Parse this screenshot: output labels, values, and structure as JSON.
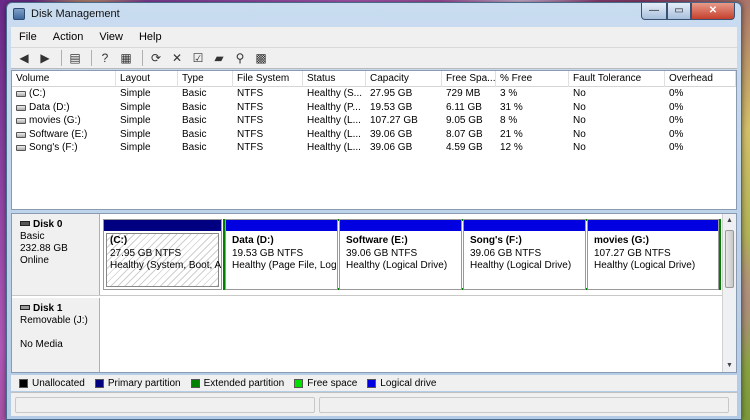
{
  "window": {
    "title": "Disk Management",
    "min_label": "—",
    "max_label": "▭",
    "close_label": "✕"
  },
  "menu": [
    "File",
    "Action",
    "View",
    "Help"
  ],
  "toolbar": {
    "buttons": [
      {
        "name": "back-arrow-icon",
        "glyph": "◀"
      },
      {
        "name": "forward-arrow-icon",
        "glyph": "▶"
      },
      {
        "name": "console-tree-icon",
        "glyph": "▤"
      },
      {
        "name": "help-icon",
        "glyph": "?"
      },
      {
        "name": "properties-icon",
        "glyph": "▦"
      },
      {
        "name": "refresh-icon",
        "glyph": "⟳"
      },
      {
        "name": "delete-icon",
        "glyph": "✕"
      },
      {
        "name": "check-icon",
        "glyph": "☑"
      },
      {
        "name": "open-folder-icon",
        "glyph": "▰"
      },
      {
        "name": "search-icon",
        "glyph": "⚲"
      },
      {
        "name": "grid-icon",
        "glyph": "▩"
      }
    ]
  },
  "volumes": {
    "columns": [
      "Volume",
      "Layout",
      "Type",
      "File System",
      "Status",
      "Capacity",
      "Free Spa...",
      "% Free",
      "Fault Tolerance",
      "Overhead"
    ],
    "rows": [
      [
        "(C:)",
        "Simple",
        "Basic",
        "NTFS",
        "Healthy (S...",
        "27.95 GB",
        "729 MB",
        "3 %",
        "No",
        "0%"
      ],
      [
        "Data (D:)",
        "Simple",
        "Basic",
        "NTFS",
        "Healthy (P...",
        "19.53 GB",
        "6.11 GB",
        "31 %",
        "No",
        "0%"
      ],
      [
        "movies (G:)",
        "Simple",
        "Basic",
        "NTFS",
        "Healthy (L...",
        "107.27 GB",
        "9.05 GB",
        "8 %",
        "No",
        "0%"
      ],
      [
        "Software (E:)",
        "Simple",
        "Basic",
        "NTFS",
        "Healthy (L...",
        "39.06 GB",
        "8.07 GB",
        "21 %",
        "No",
        "0%"
      ],
      [
        "Song's (F:)",
        "Simple",
        "Basic",
        "NTFS",
        "Healthy (L...",
        "39.06 GB",
        "4.59 GB",
        "12 %",
        "No",
        "0%"
      ]
    ]
  },
  "disk0": {
    "name": "Disk 0",
    "type": "Basic",
    "size": "232.88 GB",
    "status": "Online",
    "partitions": [
      {
        "name": "(C:)",
        "size": "27.95 GB NTFS",
        "status": "Healthy (System, Boot, Ac"
      },
      {
        "name": "Data  (D:)",
        "size": "19.53 GB NTFS",
        "status": "Healthy (Page File, Logi"
      },
      {
        "name": "Software  (E:)",
        "size": "39.06 GB NTFS",
        "status": "Healthy (Logical Drive)"
      },
      {
        "name": "Song's  (F:)",
        "size": "39.06 GB NTFS",
        "status": "Healthy (Logical Drive)"
      },
      {
        "name": "movies  (G:)",
        "size": "107.27 GB NTFS",
        "status": "Healthy (Logical Drive)"
      }
    ]
  },
  "disk1": {
    "name": "Disk 1",
    "type": "Removable (J:)",
    "status": "No Media"
  },
  "legend": [
    {
      "label": "Unallocated",
      "color": "#000000"
    },
    {
      "label": "Primary partition",
      "color": "#000080"
    },
    {
      "label": "Extended partition",
      "color": "#008000"
    },
    {
      "label": "Free space",
      "color": "#00e000"
    },
    {
      "label": "Logical drive",
      "color": "#0000e0"
    }
  ]
}
